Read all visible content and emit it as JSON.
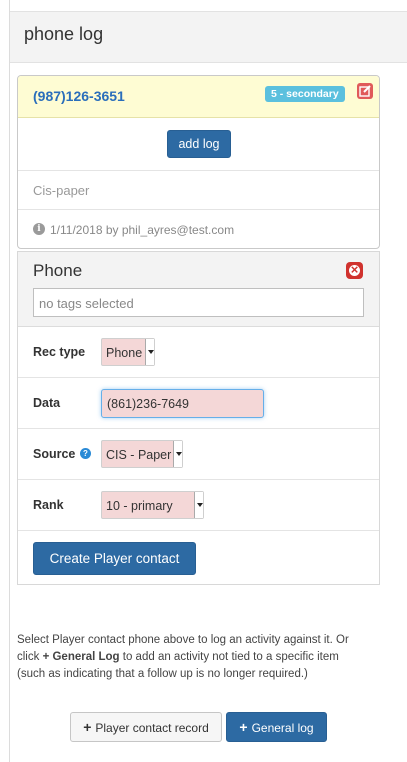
{
  "header": {
    "title": "phone log"
  },
  "record": {
    "phone": "(987)126-3651",
    "rank_badge": "5 - secondary",
    "add_log_label": "add log",
    "source": "Cis-paper",
    "meta": "1/11/2018 by phil_ayres@test.com",
    "icons": {
      "edit": "edit-icon",
      "info": "info-icon"
    },
    "colors": {
      "highlight": "#fefcd3",
      "phone": "#2a6ebb",
      "badge": "#5bc0de"
    }
  },
  "form": {
    "title": "Phone",
    "tags_placeholder": "no tags selected",
    "fields": {
      "rec_type": {
        "label": "Rec type",
        "value": "Phone"
      },
      "data": {
        "label": "Data",
        "value": "(861)236-7649"
      },
      "source": {
        "label": "Source",
        "value": "CIS - Paper"
      },
      "rank": {
        "label": "Rank",
        "value": "10 - primary"
      }
    },
    "submit_label": "Create Player contact"
  },
  "help": {
    "line1": "Select Player contact phone above to log an activity against it. Or",
    "line2_pre": "click ",
    "line2_bold": "+ General Log",
    "line2_post": " to add an activity not tied to a specific item",
    "line3": "(such as indicating that a follow up is no longer required.)"
  },
  "actions": {
    "contact_record": "Player contact record",
    "general_log": "General log"
  }
}
